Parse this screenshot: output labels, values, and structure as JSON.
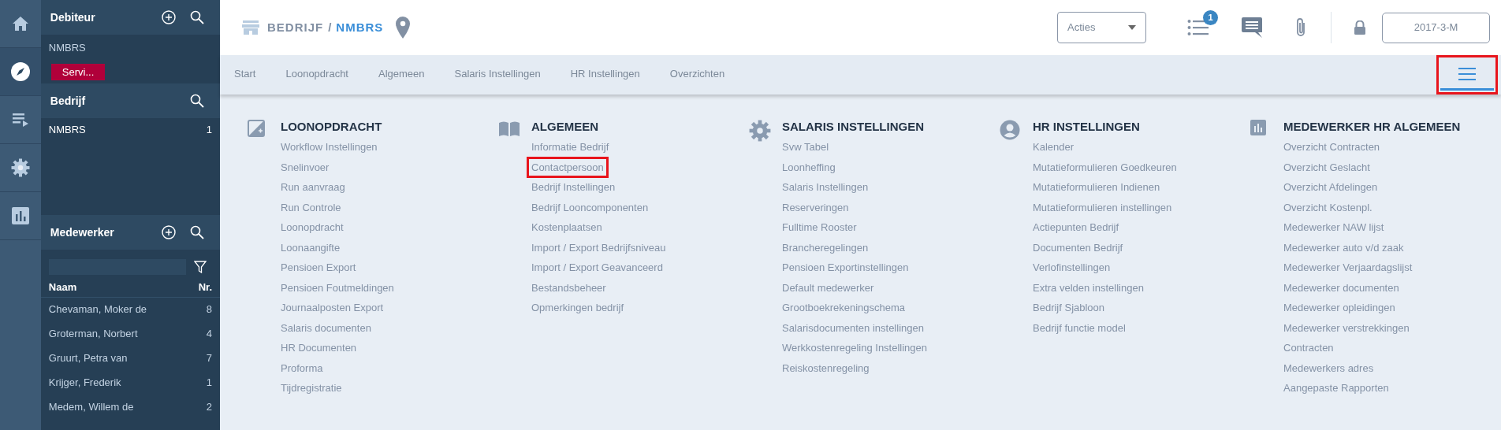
{
  "rail": [
    {
      "kind": "home",
      "selected": false
    },
    {
      "kind": "compass",
      "selected": true
    },
    {
      "kind": "list",
      "selected": false
    },
    {
      "kind": "settings",
      "selected": false
    },
    {
      "kind": "chart",
      "selected": false
    }
  ],
  "debiteur": {
    "title": "Debiteur",
    "name": "NMBRS",
    "badge": "Servi..."
  },
  "bedrijf": {
    "title": "Bedrijf",
    "rows": [
      {
        "name": "NMBRS",
        "nr": "1"
      }
    ]
  },
  "medewerker": {
    "title": "Medewerker",
    "columns": [
      "Naam",
      "Nr."
    ],
    "rows": [
      {
        "name": "Chevaman, Moker de",
        "nr": "8"
      },
      {
        "name": "Groterman, Norbert",
        "nr": "4"
      },
      {
        "name": "Gruurt, Petra van",
        "nr": "7"
      },
      {
        "name": "Krijger, Frederik",
        "nr": "1"
      },
      {
        "name": "Medem, Willem de",
        "nr": "2"
      }
    ]
  },
  "breadcrumb": {
    "section": "BEDRIJF",
    "separator": "/",
    "company": "NMBRS"
  },
  "actions": {
    "label": "Acties"
  },
  "notifications": {
    "count": "1"
  },
  "period": "2017-3-M",
  "tabs": [
    {
      "label": "Start",
      "selected": false
    },
    {
      "label": "Loonopdracht",
      "selected": false
    },
    {
      "label": "Algemeen",
      "selected": false
    },
    {
      "label": "Salaris Instellingen",
      "selected": false
    },
    {
      "label": "HR Instellingen",
      "selected": false
    },
    {
      "label": "Overzichten",
      "selected": false
    }
  ],
  "menu_button": {
    "selected": true,
    "highlighted": true
  },
  "menu": [
    {
      "kind": "edit",
      "title": "LOONOPDRACHT",
      "items": [
        {
          "label": "Workflow Instellingen",
          "highlighted": false
        },
        {
          "label": "Snelinvoer",
          "highlighted": false
        },
        {
          "label": "Run aanvraag",
          "highlighted": false
        },
        {
          "label": "Run Controle",
          "highlighted": false
        },
        {
          "label": "Loonopdracht",
          "highlighted": false
        },
        {
          "label": "Loonaangifte",
          "highlighted": false
        },
        {
          "label": "Pensioen Export",
          "highlighted": false
        },
        {
          "label": "Pensioen Foutmeldingen",
          "highlighted": false
        },
        {
          "label": "Journaalposten Export",
          "highlighted": false
        },
        {
          "label": "Salaris documenten",
          "highlighted": false
        },
        {
          "label": "HR Documenten",
          "highlighted": false
        },
        {
          "label": "Proforma",
          "highlighted": false
        },
        {
          "label": "Tijdregistratie",
          "highlighted": false
        }
      ]
    },
    {
      "kind": "book",
      "title": "ALGEMEEN",
      "items": [
        {
          "label": "Informatie Bedrijf",
          "highlighted": false
        },
        {
          "label": "Contactpersoon",
          "highlighted": true
        },
        {
          "label": "Bedrijf Instellingen",
          "highlighted": false
        },
        {
          "label": "Bedrijf Looncomponenten",
          "highlighted": false
        },
        {
          "label": "Kostenplaatsen",
          "highlighted": false
        },
        {
          "label": "Import / Export Bedrijfsniveau",
          "highlighted": false
        },
        {
          "label": "Import / Export Geavanceerd",
          "highlighted": false
        },
        {
          "label": "Bestandsbeheer",
          "highlighted": false
        },
        {
          "label": "Opmerkingen bedrijf",
          "highlighted": false
        }
      ]
    },
    {
      "kind": "gear",
      "title": "SALARIS INSTELLINGEN",
      "items": [
        {
          "label": "Svw Tabel",
          "highlighted": false
        },
        {
          "label": "Loonheffing",
          "highlighted": false
        },
        {
          "label": "Salaris Instellingen",
          "highlighted": false
        },
        {
          "label": "Reserveringen",
          "highlighted": false
        },
        {
          "label": "Fulltime Rooster",
          "highlighted": false
        },
        {
          "label": "Brancheregelingen",
          "highlighted": false
        },
        {
          "label": "Pensioen Exportinstellingen",
          "highlighted": false
        },
        {
          "label": "Default medewerker",
          "highlighted": false
        },
        {
          "label": "Grootboekrekeningschema",
          "highlighted": false
        },
        {
          "label": "Salarisdocumenten instellingen",
          "highlighted": false
        },
        {
          "label": "Werkkostenregeling Instellingen",
          "highlighted": false
        },
        {
          "label": "Reiskostenregeling",
          "highlighted": false
        }
      ]
    },
    {
      "kind": "person",
      "title": "HR INSTELLINGEN",
      "items": [
        {
          "label": "Kalender",
          "highlighted": false
        },
        {
          "label": "Mutatieformulieren Goedkeuren",
          "highlighted": false
        },
        {
          "label": "Mutatieformulieren Indienen",
          "highlighted": false
        },
        {
          "label": "Mutatieformulieren instellingen",
          "highlighted": false
        },
        {
          "label": "Actiepunten Bedrijf",
          "highlighted": false
        },
        {
          "label": "Documenten Bedrijf",
          "highlighted": false
        },
        {
          "label": "Verlofinstellingen",
          "highlighted": false
        },
        {
          "label": "Extra velden instellingen",
          "highlighted": false
        },
        {
          "label": "Bedrijf Sjabloon",
          "highlighted": false
        },
        {
          "label": "Bedrijf functie model",
          "highlighted": false
        }
      ]
    },
    {
      "kind": "chart",
      "title": "MEDEWERKER HR ALGEMEEN",
      "items": [
        {
          "label": "Overzicht Contracten",
          "highlighted": false
        },
        {
          "label": "Overzicht Geslacht",
          "highlighted": false
        },
        {
          "label": "Overzicht Afdelingen",
          "highlighted": false
        },
        {
          "label": "Overzicht Kostenpl.",
          "highlighted": false
        },
        {
          "label": "Medewerker NAW lijst",
          "highlighted": false
        },
        {
          "label": "Medewerker auto v/d zaak",
          "highlighted": false
        },
        {
          "label": "Medewerker Verjaardagslijst",
          "highlighted": false
        },
        {
          "label": "Medewerker documenten",
          "highlighted": false
        },
        {
          "label": "Medewerker opleidingen",
          "highlighted": false
        },
        {
          "label": "Medewerker verstrekkingen",
          "highlighted": false
        },
        {
          "label": "Contracten",
          "highlighted": false
        },
        {
          "label": "Medewerkers adres",
          "highlighted": false
        },
        {
          "label": "Aangepaste Rapporten",
          "highlighted": false
        }
      ]
    }
  ]
}
